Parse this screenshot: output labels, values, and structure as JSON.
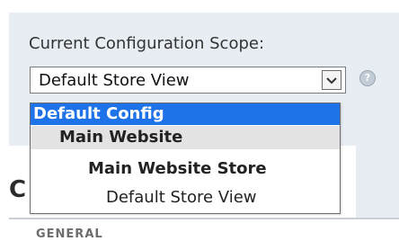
{
  "scope": {
    "label": "Current Configuration Scope:",
    "selected": "Default Store View",
    "help_icon": "help-question-icon",
    "arrow_icon": "chevron-down-icon",
    "options": [
      {
        "label": "Default Config",
        "state": "highlighted"
      },
      {
        "label": "Main Website",
        "state": "group"
      },
      {
        "label": "Main Website Store",
        "state": "group"
      },
      {
        "label": "Default Store View",
        "state": "normal"
      }
    ]
  },
  "page": {
    "title_fragment": "C",
    "section_fragment": "GENERAL"
  },
  "colors": {
    "panel_bg": "#e7edf3",
    "highlight": "#1e73e8",
    "highlight_text": "#ffffff",
    "group_bg": "#e3e3e3",
    "text": "#222222"
  }
}
